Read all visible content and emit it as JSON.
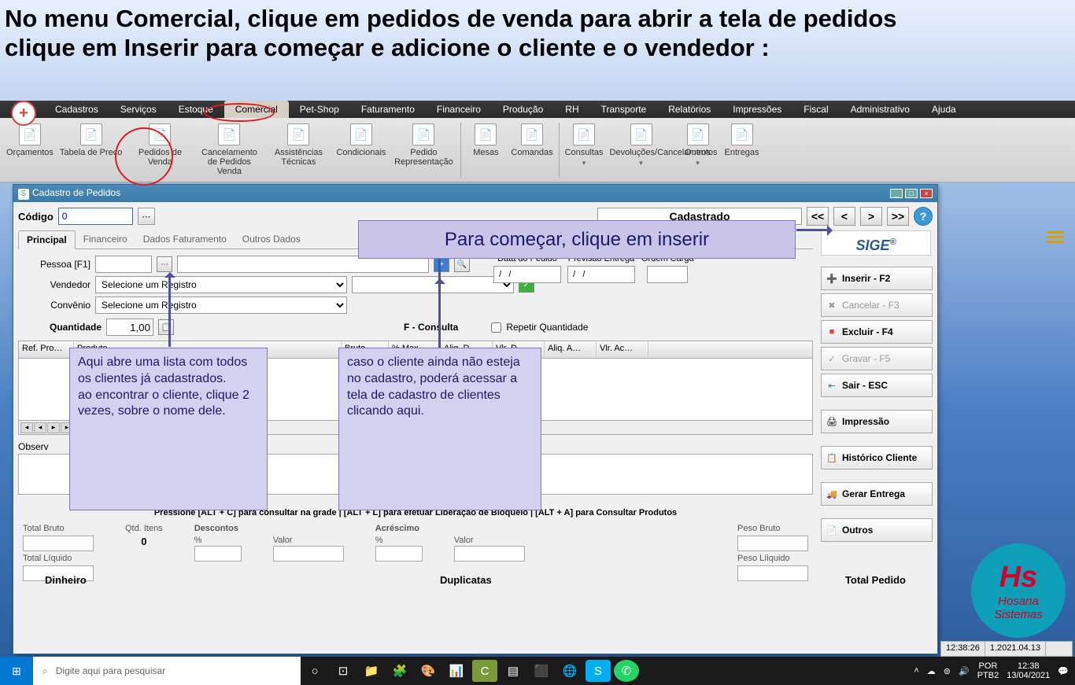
{
  "instruction": "No menu Comercial, clique em pedidos de venda para abrir a tela de pedidos\nclique em Inserir para começar e adicione o cliente e o vendedor :",
  "menubar": {
    "items": [
      "Cadastros",
      "Serviços",
      "Estoque",
      "Comercial",
      "Pet-Shop",
      "Faturamento",
      "Financeiro",
      "Produção",
      "RH",
      "Transporte",
      "Relatórios",
      "Impressões",
      "Fiscal",
      "Administrativo",
      "Ajuda"
    ],
    "active": "Comercial"
  },
  "ribbon": {
    "items": [
      {
        "label": "Orçamentos"
      },
      {
        "label": "Tabela de Preço"
      },
      {
        "label": "Pedidos de Venda"
      },
      {
        "label": "Cancelamento de Pedidos Venda"
      },
      {
        "label": "Assistências Técnicas"
      },
      {
        "label": "Condicionais"
      },
      {
        "label": "Pedido Representação"
      },
      {
        "label": "Mesas"
      },
      {
        "label": "Comandas"
      },
      {
        "label": "Consultas",
        "drop": true
      },
      {
        "label": "Devoluções/Cancelamentos",
        "drop": true
      },
      {
        "label": "Outros",
        "drop": true
      },
      {
        "label": "Entregas"
      }
    ]
  },
  "window": {
    "title": "Cadastro de Pedidos",
    "codigo_label": "Código",
    "codigo_value": "0",
    "status": "Cadastrado",
    "nav": {
      "first": "<<",
      "prev": "<",
      "next": ">",
      "last": ">>",
      "help": "?"
    },
    "tabs": [
      "Principal",
      "Financeiro",
      "Dados Faturamento",
      "Outros Dados"
    ],
    "form": {
      "pessoa_label": "Pessoa  [F1]",
      "vendedor_label": "Vendedor",
      "vendedor_placeholder": "Selecione um Registro",
      "convenio_label": "Convênio",
      "convenio_placeholder": "Selecione um Registro",
      "data_pedido": "Data do Pedido",
      "previsao": "Previsão Entrega",
      "ordem": "Ordem Carga",
      "date_val": "  /   /",
      "qty_label": "Quantidade",
      "qty_val": "1,00",
      "f_consulta": "F - Consulta",
      "repetir": "Repetir Quantidade"
    },
    "grid_cols": [
      "Ref. Pro…",
      "Produto",
      "Bruto",
      "% Max…",
      "Aliq. D…",
      "Vlr. D…",
      "Aliq. A…",
      "Vlr. Ac…"
    ],
    "obs_label": "Observ",
    "help_line": "Pressione [ALT + C] para consultar na grade  |  [ALT + L] para efetuar Liberação de Bloqueio  |  [ALT + A] para Consultar Produtos",
    "totals": {
      "total_bruto": "Total Bruto",
      "qtd_itens_label": "Qtd. Itens",
      "qtd_itens_val": "0",
      "total_liquido": "Total Líquido",
      "descontos": "Descontos",
      "acrescimo": "Acréscimo",
      "pct": "%",
      "valor": "Valor",
      "peso_bruto": "Peso Bruto",
      "peso_liquido": "Peso Líiquido"
    },
    "footer": {
      "dinheiro": "Dinheiro",
      "duplicatas": "Duplicatas",
      "total": "Total Pedido"
    },
    "side": {
      "logo": "SIGE",
      "inserir": "Inserir  - F2",
      "cancelar": "Cancelar - F3",
      "excluir": "Excluir  - F4",
      "gravar": "Gravar - F5",
      "sair": "Sair  -  ESC",
      "impressao": "Impressão",
      "historico": "Histórico Cliente",
      "gerar": "Gerar Entrega",
      "outros": "Outros"
    }
  },
  "callouts": {
    "top": "Para começar, clique em inserir",
    "c1": "Aqui abre uma lista com todos os clientes já cadastrados.\nao encontrar o cliente, clique 2 vezes, sobre o nome dele.",
    "c2": "caso o cliente ainda não esteja no cadastro, poderá acessar a tela de cadastro de clientes clicando aqui."
  },
  "status_footer": {
    "time": "12:38:26",
    "ver": "1.2021.04.13"
  },
  "taskbar": {
    "search_placeholder": "Digite aqui para pesquisar",
    "lang1": "POR",
    "lang2": "PTB2",
    "clock": "12:38",
    "date": "13/04/2021"
  },
  "logo": {
    "l1": "Hs",
    "l2": "Hosana",
    "l3": "Sistemas"
  }
}
